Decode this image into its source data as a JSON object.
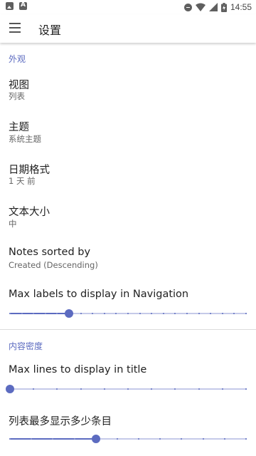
{
  "statusbar": {
    "time": "14:55",
    "battery_level": 0.8,
    "accent": "#5f5f5f"
  },
  "appbar": {
    "title": "设置"
  },
  "sections": {
    "appearance": {
      "header": "外观"
    },
    "density": {
      "header": "内容密度"
    }
  },
  "prefs": {
    "view": {
      "title": "视图",
      "summary": "列表"
    },
    "theme": {
      "title": "主题",
      "summary": "系统主题"
    },
    "date_format": {
      "title": "日期格式",
      "summary": "1 天 前"
    },
    "text_size": {
      "title": "文本大小",
      "summary": "中"
    },
    "notes_sorted": {
      "title": "Notes sorted by",
      "summary": "Created (Descending)"
    },
    "max_labels": {
      "title": "Max labels to display in Navigation",
      "value": 5,
      "min": 0,
      "max": 20
    },
    "max_lines_title": {
      "title": "Max lines to display in title",
      "value": 0,
      "min": 0,
      "max": 10
    },
    "list_max_items": {
      "title": "列表最多显示多少条目",
      "value": 4,
      "min": 0,
      "max": 11
    }
  },
  "colors": {
    "accent": "#5c6bc0",
    "track": "#c5cae9",
    "text": "#212121",
    "summary": "#666666"
  }
}
